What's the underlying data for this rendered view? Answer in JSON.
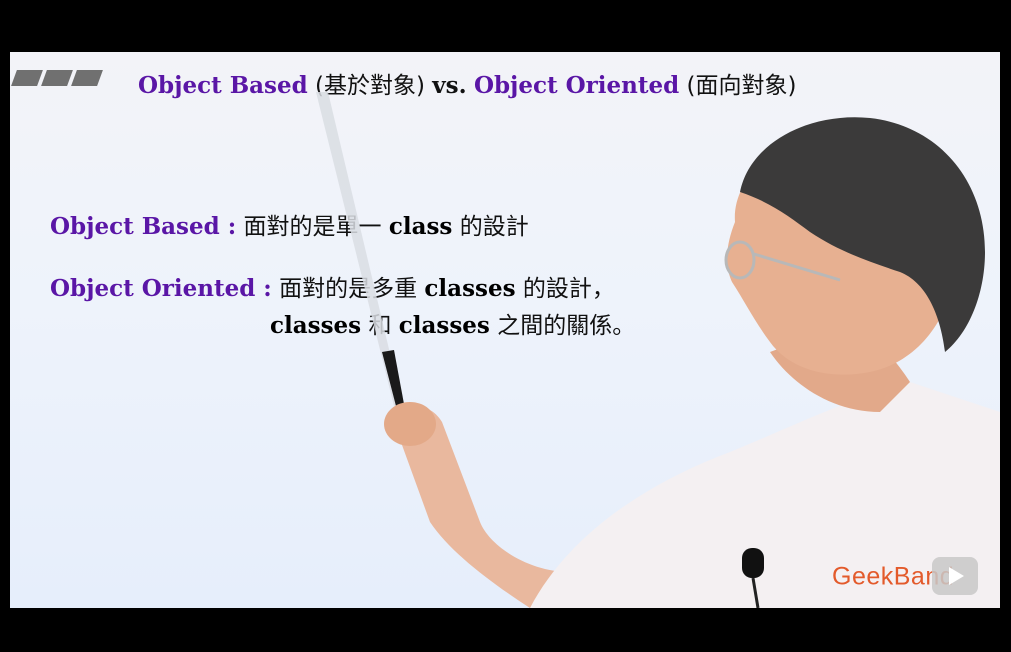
{
  "slide": {
    "title": {
      "ob_en": "Object Based",
      "ob_zh": "(基於對象)",
      "vs": "vs.",
      "oo_en": "Object Oriented",
      "oo_zh": "(面向對象)"
    },
    "line1": {
      "term": "Object Based :",
      "text_a": "面對的是單一",
      "code": "class",
      "text_b": "的設計"
    },
    "line2": {
      "term": "Object Oriented :",
      "text_a": "面對的是多重",
      "code": "classes",
      "text_b": "的設計，"
    },
    "line3": {
      "code_a": "classes",
      "text_a": "和",
      "code_b": "classes",
      "text_b": "之間的關係。"
    }
  },
  "watermark": {
    "brand": "GeekBand"
  },
  "colors": {
    "term_purple": "#5a16a6",
    "brand_orange": "#e35a2b"
  }
}
